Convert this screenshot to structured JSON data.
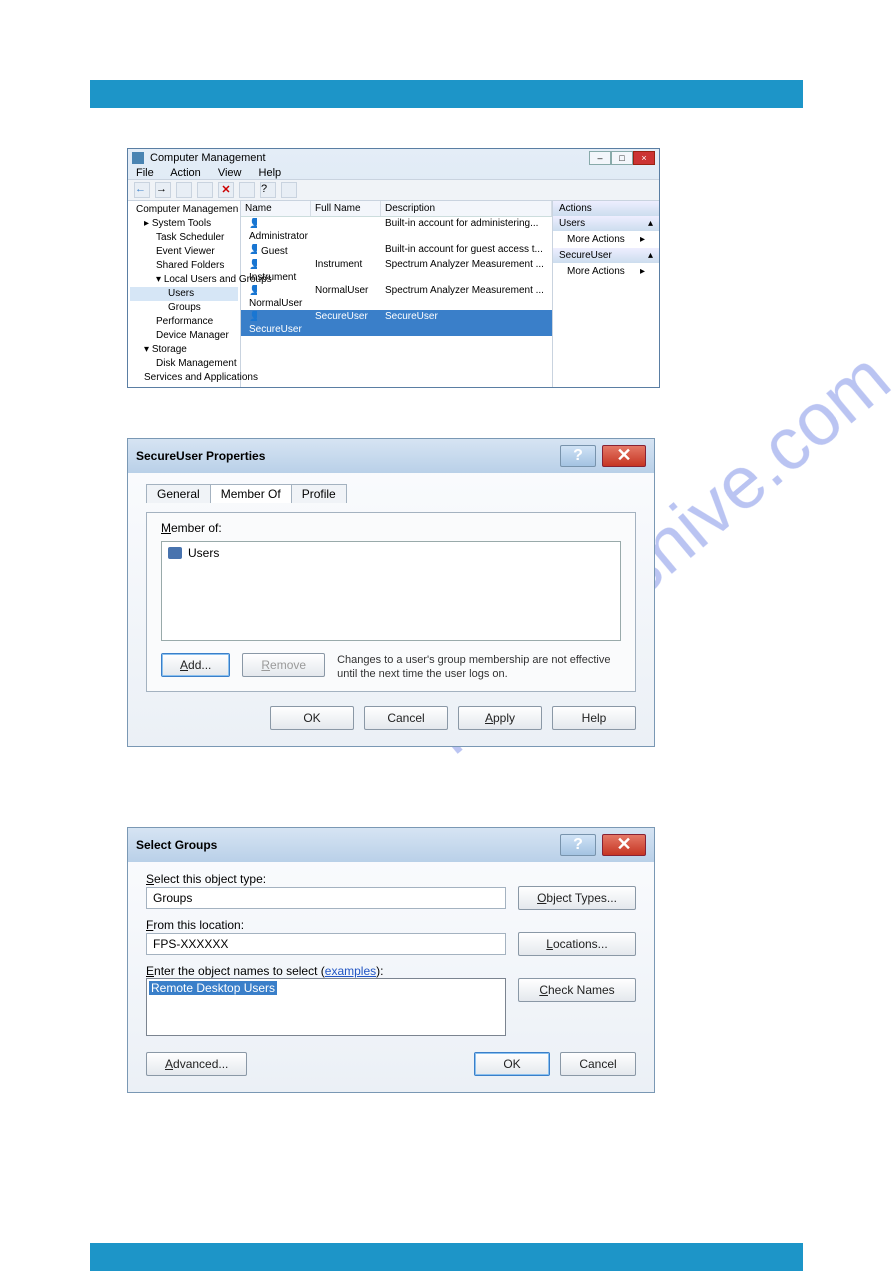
{
  "cm": {
    "title": "Computer Management",
    "menu": [
      "File",
      "Action",
      "View",
      "Help"
    ],
    "tree": {
      "root": "Computer Management (Local)",
      "system_tools": "System Tools",
      "items": [
        "Task Scheduler",
        "Event Viewer",
        "Shared Folders"
      ],
      "lug": "Local Users and Groups",
      "users": "Users",
      "groups": "Groups",
      "perf": "Performance",
      "devmgr": "Device Manager",
      "storage": "Storage",
      "diskmgmt": "Disk Management",
      "svc": "Services and Applications"
    },
    "cols": {
      "name": "Name",
      "full": "Full Name",
      "desc": "Description"
    },
    "rows": [
      {
        "name": "Administrator",
        "full": "",
        "desc": "Built-in account for administering..."
      },
      {
        "name": "Guest",
        "full": "",
        "desc": "Built-in account for guest access t..."
      },
      {
        "name": "Instrument",
        "full": "Instrument",
        "desc": "Spectrum Analyzer Measurement ..."
      },
      {
        "name": "NormalUser",
        "full": "NormalUser",
        "desc": "Spectrum Analyzer Measurement ..."
      },
      {
        "name": "SecureUser",
        "full": "SecureUser",
        "desc": "SecureUser"
      }
    ],
    "actions": {
      "head": "Actions",
      "users": "Users",
      "more": "More Actions",
      "secure": "SecureUser"
    }
  },
  "props": {
    "title": "SecureUser Properties",
    "tabs": {
      "general": "General",
      "memberof": "Member Of",
      "profile": "Profile"
    },
    "label": "Member of:",
    "list": [
      {
        "name": "Users"
      }
    ],
    "buttons": {
      "add": "Add...",
      "remove": "Remove"
    },
    "note": "Changes to a user's group membership are not effective until the next time the user logs on.",
    "ok": "OK",
    "cancel": "Cancel",
    "apply": "Apply",
    "help": "Help"
  },
  "sel": {
    "title": "Select Groups",
    "obj_label": "Select this object type:",
    "obj_val": "Groups",
    "obj_btn": "Object Types...",
    "loc_label": "From this location:",
    "loc_val": "FPS-XXXXXX",
    "loc_btn": "Locations...",
    "enter_pre": "Enter the object names to select (",
    "examples": "examples",
    "enter_post": "):",
    "entered": "Remote Desktop Users",
    "check": "Check Names",
    "adv": "Advanced...",
    "ok": "OK",
    "cancel": "Cancel"
  },
  "watermark": "manualshive.com"
}
